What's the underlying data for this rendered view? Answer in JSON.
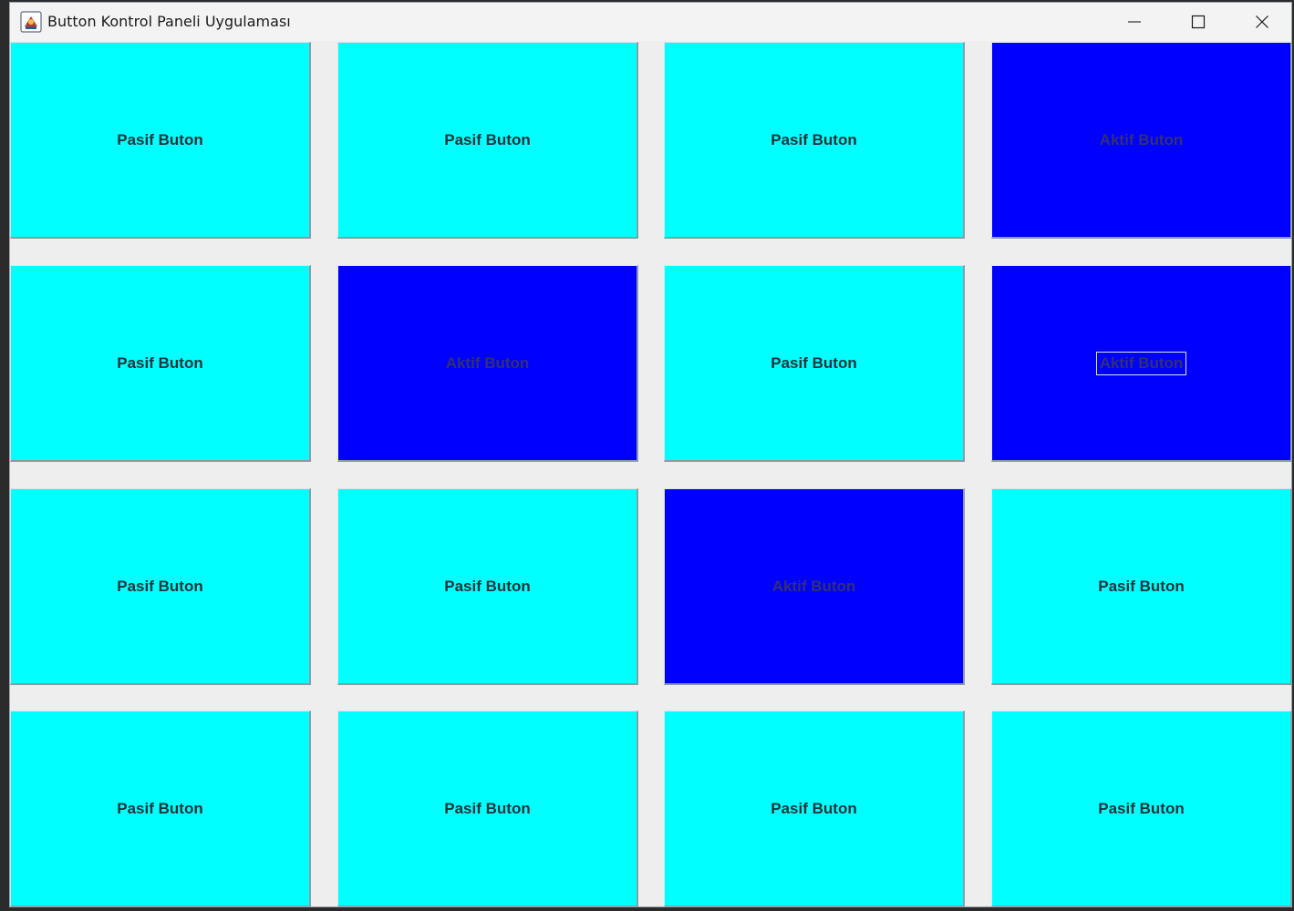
{
  "window": {
    "title": "Button Kontrol Paneli Uygulaması",
    "icon": "java-app-icon",
    "controls": [
      "minimize-icon",
      "maximize-icon",
      "close-icon"
    ]
  },
  "colors": {
    "pasif": "#00ffff",
    "aktif": "#0000ff",
    "background": "#eeeeee"
  },
  "buttons": [
    {
      "label": "Pasif Buton",
      "state": "pasif"
    },
    {
      "label": "Pasif Buton",
      "state": "pasif"
    },
    {
      "label": "Pasif Buton",
      "state": "pasif"
    },
    {
      "label": "Aktif Buton",
      "state": "aktif"
    },
    {
      "label": "Pasif Buton",
      "state": "pasif"
    },
    {
      "label": "Aktif Buton",
      "state": "aktif"
    },
    {
      "label": "Pasif Buton",
      "state": "pasif"
    },
    {
      "label": "Aktif Buton",
      "state": "aktif",
      "focused": true
    },
    {
      "label": "Pasif Buton",
      "state": "pasif"
    },
    {
      "label": "Pasif Buton",
      "state": "pasif"
    },
    {
      "label": "Aktif Buton",
      "state": "aktif"
    },
    {
      "label": "Pasif Buton",
      "state": "pasif"
    },
    {
      "label": "Pasif Buton",
      "state": "pasif"
    },
    {
      "label": "Pasif Buton",
      "state": "pasif"
    },
    {
      "label": "Pasif Buton",
      "state": "pasif"
    },
    {
      "label": "Pasif Buton",
      "state": "pasif"
    }
  ]
}
